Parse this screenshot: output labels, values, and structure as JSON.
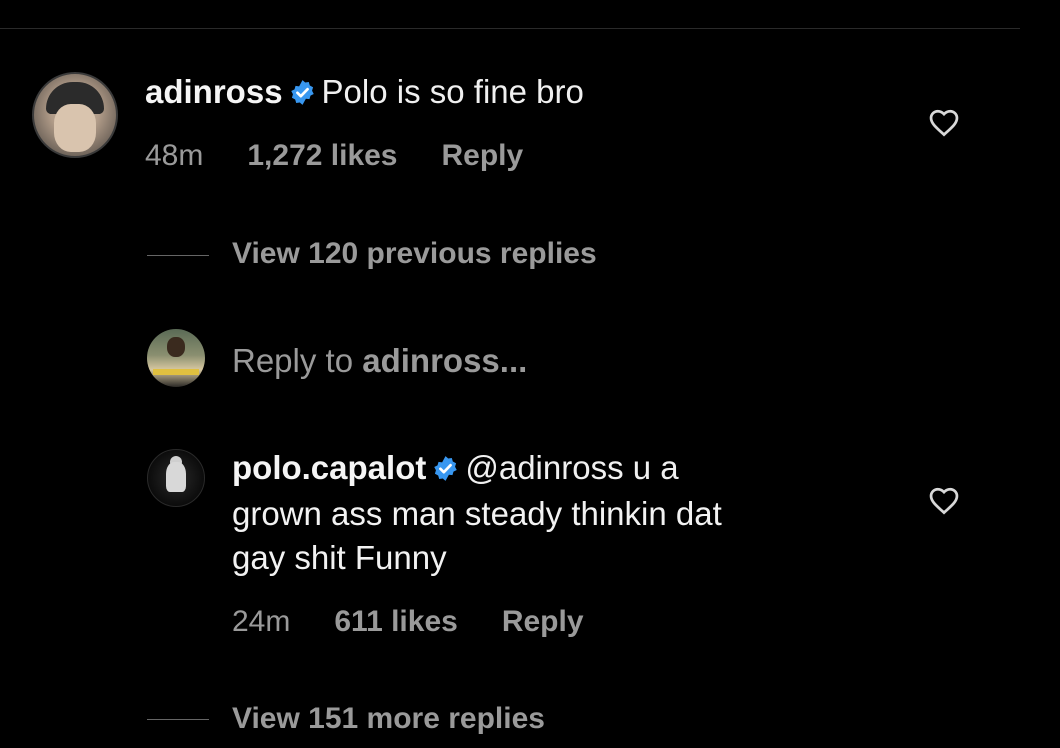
{
  "comment": {
    "username": "adinross",
    "text": "Polo is so fine bro",
    "time": "48m",
    "likes": "1,272 likes",
    "reply_label": "Reply",
    "heart_icon": "heart-outline-icon"
  },
  "view_previous": "View 120 previous replies",
  "reply_prompt": {
    "prefix": "Reply to ",
    "target": "adinross..."
  },
  "reply": {
    "username": "polo.capalot",
    "mention": "@adinross",
    "text_line1": " u a",
    "text_line2": "grown ass man steady thinkin dat",
    "text_line3": "gay shit Funny",
    "time": "24m",
    "likes": "611 likes",
    "reply_label": "Reply"
  },
  "view_more": "View 151 more replies",
  "colors": {
    "background": "#000000",
    "muted": "#9a9a9a",
    "verified_badge": "#3897f0"
  }
}
